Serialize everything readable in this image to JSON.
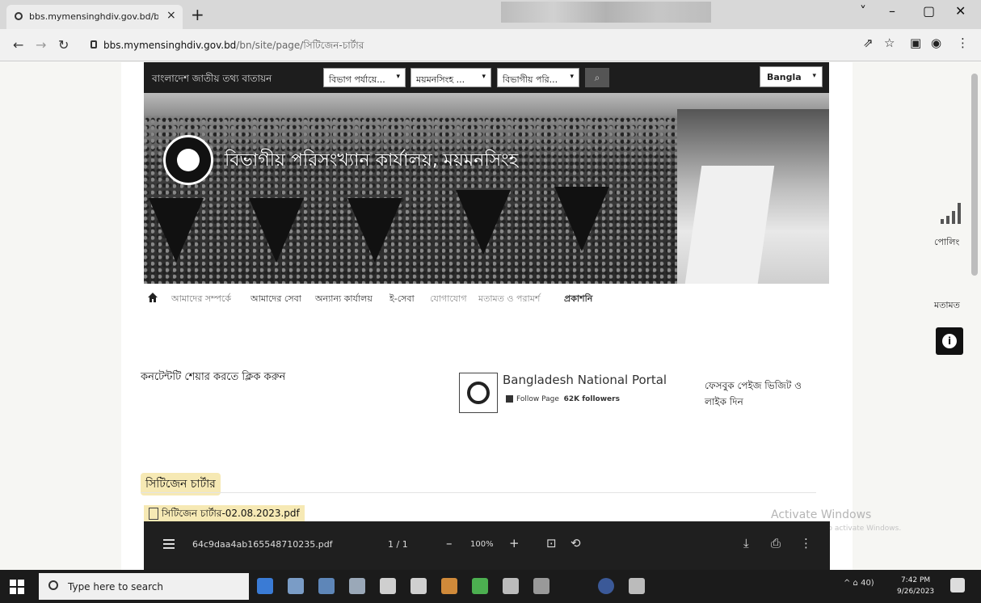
{
  "browser": {
    "tab_title": "bbs.mymensinghdiv.gov.bd/bn/",
    "tab_close": "×",
    "new_tab": "+",
    "window_controls": [
      "˅",
      "–",
      "▢",
      "✕"
    ],
    "url_host": "bbs.mymensinghdiv.gov.bd",
    "url_path": "/bn/site/page/সিটিজেন-চার্টার",
    "icons": [
      "share-icon",
      "star-icon",
      "sidepanel-icon",
      "profile-icon",
      "menu-icon"
    ]
  },
  "site": {
    "brand_text": "বাংলাদেশ জাতীয় তথ্য বাতায়ন",
    "selects": [
      "বিভাগ পর্যায়ে...",
      "ময়মনসিংহ ...",
      "বিভাগীয় পরি..."
    ],
    "search_icon": "⌕",
    "language": "Bangla",
    "banner_title": "বিভাগীয় পরিসংখ্যান কার্যালয়, ময়মনসিংহ",
    "menu": [
      "আমাদের সম্পর্কে",
      "আমাদের সেবা",
      "অন্যান্য কার্যালয়",
      "ই-সেবা",
      "যোগাযোগ",
      "মতামত ও পরামর্শ",
      "প্রকাশনি"
    ],
    "content_prompt": "কনটেন্টটি শেয়ার করতে ক্লিক করুন",
    "fb": {
      "name": "Bangladesh National Portal",
      "follow": "Follow Page",
      "followers": "62K followers",
      "side_text": "ফেসবুক পেইজ ভিজিট ও লাইক দিন"
    },
    "section_title": "সিটিজেন চার্টার",
    "file_link": "সিটিজেন চার্টার-02.08.2023.pdf"
  },
  "widgets": {
    "poll_label": "পোলিং",
    "opinion_label": "মতামত",
    "info": "i"
  },
  "watermark": {
    "title": "Activate Windows",
    "subtitle": "Go to Settings to activate Windows."
  },
  "pdf": {
    "filename": "64c9daa4ab165548710235.pdf",
    "page": "1 / 1",
    "minus": "–",
    "zoom": "100%",
    "plus": "+",
    "fit": "⊡",
    "rotate": "⟲",
    "download": "⤓",
    "print": "⎙",
    "more": "⋮"
  },
  "taskbar": {
    "search_placeholder": "Type here to search",
    "time": "7:42 PM",
    "date": "9/26/2023",
    "tray_text": "^ ⌂ 40)"
  }
}
